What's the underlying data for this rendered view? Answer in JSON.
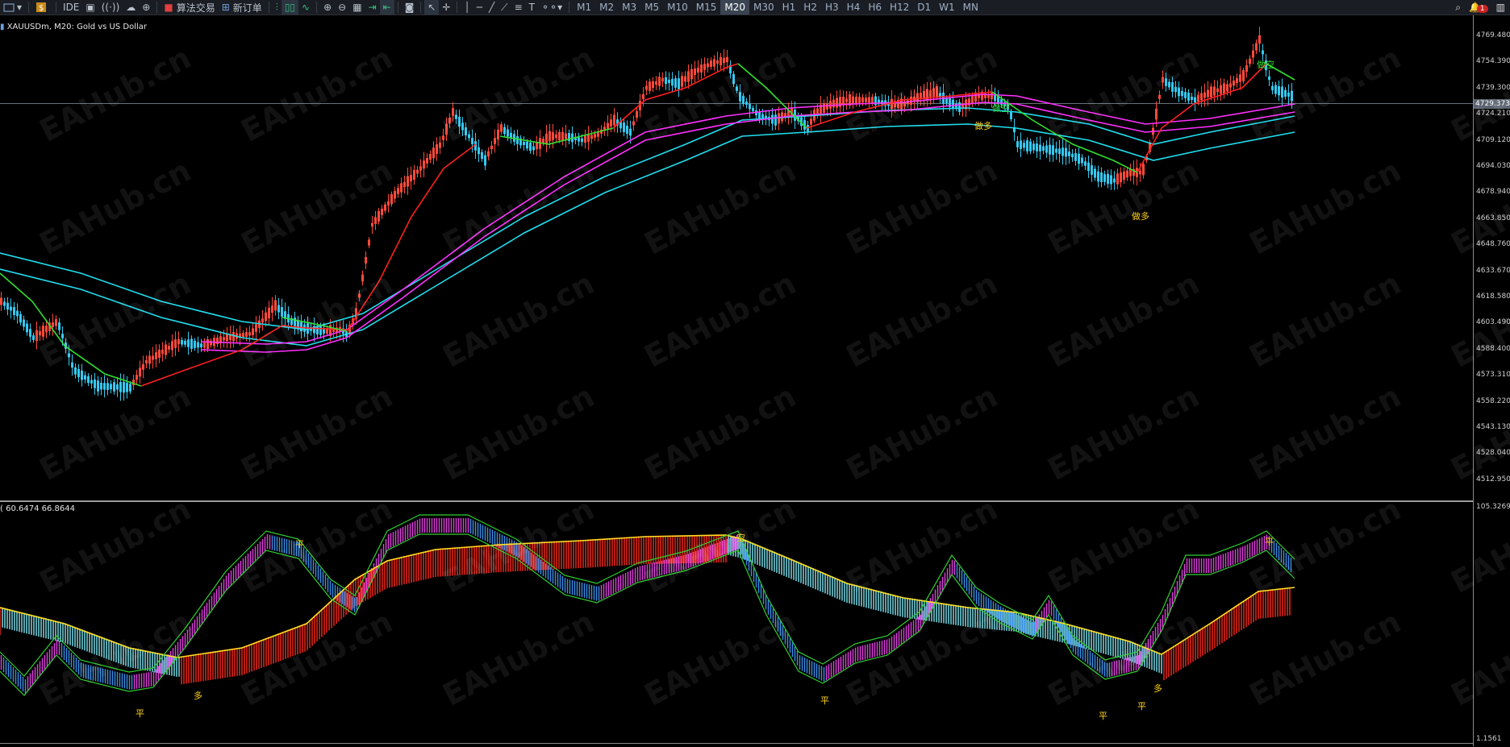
{
  "toolbar": {
    "ide": "IDE",
    "algo": "算法交易",
    "new_order": "新订单",
    "timeframes": [
      "M1",
      "M2",
      "M3",
      "M5",
      "M10",
      "M15",
      "M20",
      "M30",
      "H1",
      "H2",
      "H3",
      "H4",
      "H6",
      "H12",
      "D1",
      "W1",
      "MN"
    ],
    "active_timeframe": "M20",
    "notif_count": "1"
  },
  "chart": {
    "title": "XAUUSDm, M20:  Gold vs US Dollar",
    "current_price": "4729.373",
    "price_ticks": [
      "4769.480",
      "4754.390",
      "4739.300",
      "4724.210",
      "4709.120",
      "4694.030",
      "4678.940",
      "4663.850",
      "4648.760",
      "4633.670",
      "4618.580",
      "4603.490",
      "4588.400",
      "4573.310",
      "4558.220",
      "4543.130",
      "4528.040",
      "4512.950"
    ],
    "signals": [
      {
        "text": "做空"
      },
      {
        "text": "做多"
      },
      {
        "text": "做空"
      },
      {
        "text": "做多"
      }
    ],
    "watermark": "EAHub.cn"
  },
  "oscillator": {
    "title": "( 60.6474 66.8644",
    "top_value": "105.3269",
    "bottom_value": "1.1561",
    "signals": [
      {
        "text": "平"
      },
      {
        "text": "多"
      },
      {
        "text": "平"
      },
      {
        "text": "空"
      },
      {
        "text": "平"
      },
      {
        "text": "平"
      },
      {
        "text": "平"
      },
      {
        "text": "多"
      },
      {
        "text": "平"
      }
    ]
  },
  "colors": {
    "bull_candle": "#ff4a3a",
    "bear_candle": "#35c8f0",
    "ma_red": "#ff2020",
    "ma_green": "#30e030",
    "ma_cyan": "#20e0f0",
    "ma_magenta": "#ff30ff"
  }
}
